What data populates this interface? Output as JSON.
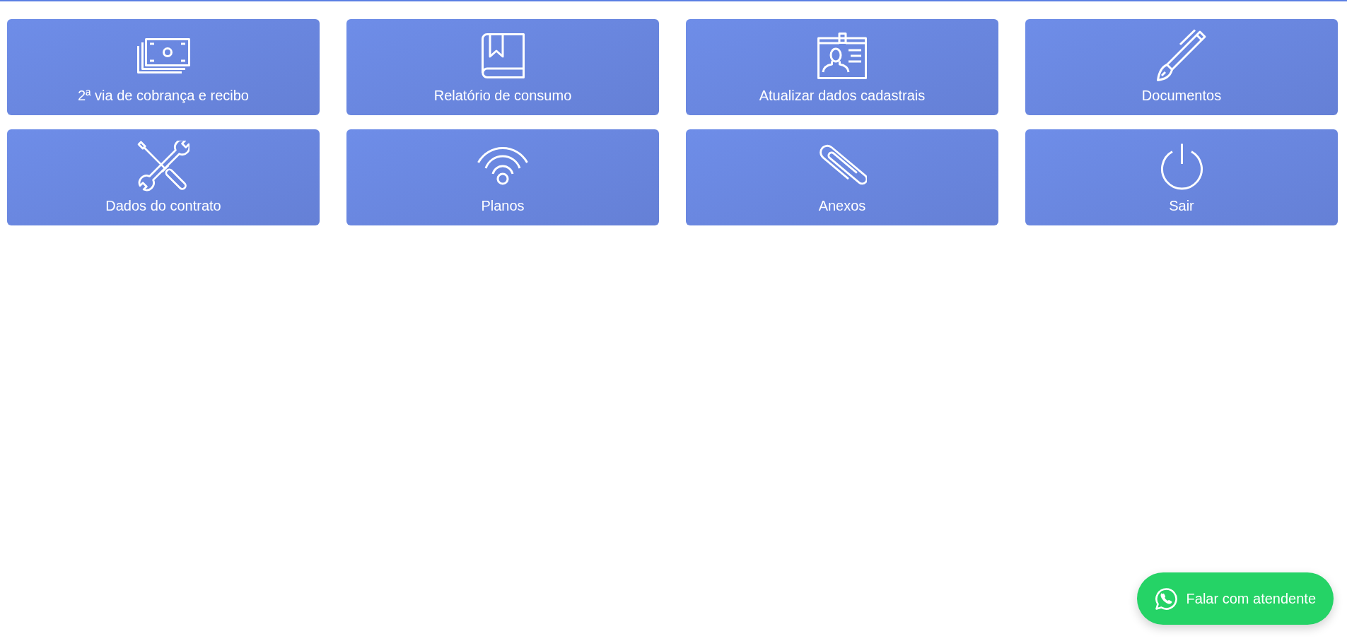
{
  "menu_tiles": [
    {
      "label": "2ª via de cobrança e recibo"
    },
    {
      "label": "Relatório de consumo"
    },
    {
      "label": "Atualizar dados cadastrais"
    },
    {
      "label": "Documentos"
    },
    {
      "label": "Dados do contrato"
    },
    {
      "label": "Planos"
    },
    {
      "label": "Anexos"
    },
    {
      "label": "Sair"
    }
  ],
  "chat_button": {
    "label": "Falar com atendente"
  }
}
